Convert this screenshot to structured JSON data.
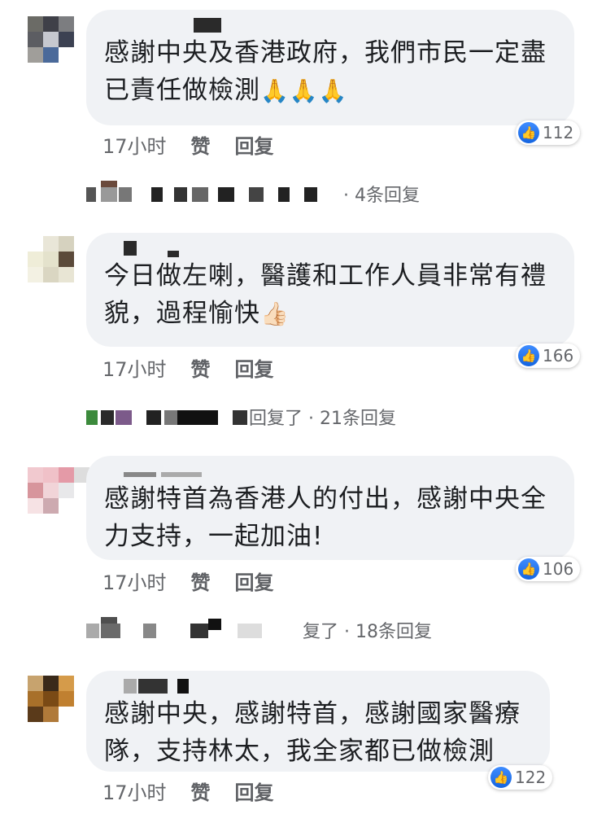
{
  "comments": [
    {
      "text": "感謝中央及香港政府，我們市民一定盡已責任做檢測",
      "emoji": "🙏🙏🙏",
      "time": "17小时",
      "like_label": "赞",
      "reply_label": "回复",
      "likes": "112",
      "reply_summary": "· 4条回复"
    },
    {
      "text": "今日做左喇，醫護和工作人員非常有禮貌，過程愉快",
      "emoji": "👍🏻",
      "time": "17小时",
      "like_label": "赞",
      "reply_label": "回复",
      "likes": "166",
      "reply_summary": "回复了 · 21条回复"
    },
    {
      "text": "感謝特首為香港人的付出，感謝中央全力支持，一起加油!",
      "emoji": "",
      "time": "17小时",
      "like_label": "赞",
      "reply_label": "回复",
      "likes": "106",
      "reply_summary": "复了 · 18条回复"
    },
    {
      "text": "感謝中央，感謝特首，感謝國家醫療隊，支持林太，我全家都已做檢測",
      "emoji": "",
      "time": "17小时",
      "like_label": "赞",
      "reply_label": "回复",
      "likes": "122"
    }
  ],
  "icons": {
    "like": "thumbs-up-icon"
  },
  "colors": {
    "like_blue": "#1877f2",
    "bubble": "#f0f2f5",
    "meta_gray": "#65676b"
  }
}
